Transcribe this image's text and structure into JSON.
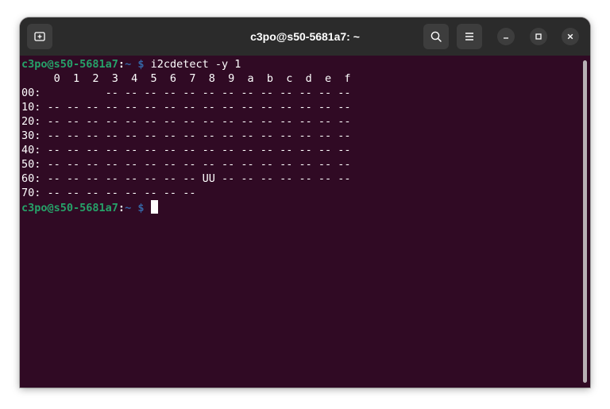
{
  "window": {
    "title": "c3po@s50-5681a7: ~"
  },
  "titlebar": {
    "new_tab_icon": "new-tab-icon",
    "search_icon": "search-icon",
    "menu_icon": "hamburger-menu-icon",
    "minimize_icon": "minimize-icon",
    "maximize_icon": "maximize-icon",
    "close_icon": "close-icon"
  },
  "terminal": {
    "prompt": {
      "user_host": "c3po@s50-5681a7",
      "colon": ":",
      "path": "~",
      "dollar": "$"
    },
    "command": " i2cdetect -y 1",
    "output_lines": [
      "     0  1  2  3  4  5  6  7  8  9  a  b  c  d  e  f",
      "00:          -- -- -- -- -- -- -- -- -- -- -- -- --",
      "10: -- -- -- -- -- -- -- -- -- -- -- -- -- -- -- --",
      "20: -- -- -- -- -- -- -- -- -- -- -- -- -- -- -- --",
      "30: -- -- -- -- -- -- -- -- -- -- -- -- -- -- -- --",
      "40: -- -- -- -- -- -- -- -- -- -- -- -- -- -- -- --",
      "50: -- -- -- -- -- -- -- -- -- -- -- -- -- -- -- --",
      "60: -- -- -- -- -- -- -- -- UU -- -- -- -- -- -- --",
      "70: -- -- -- -- -- -- -- --"
    ]
  },
  "colors": {
    "terminal_bg": "#300a24",
    "titlebar_bg": "#2b2b2b",
    "prompt_user": "#26a269",
    "prompt_path": "#3465a4"
  }
}
